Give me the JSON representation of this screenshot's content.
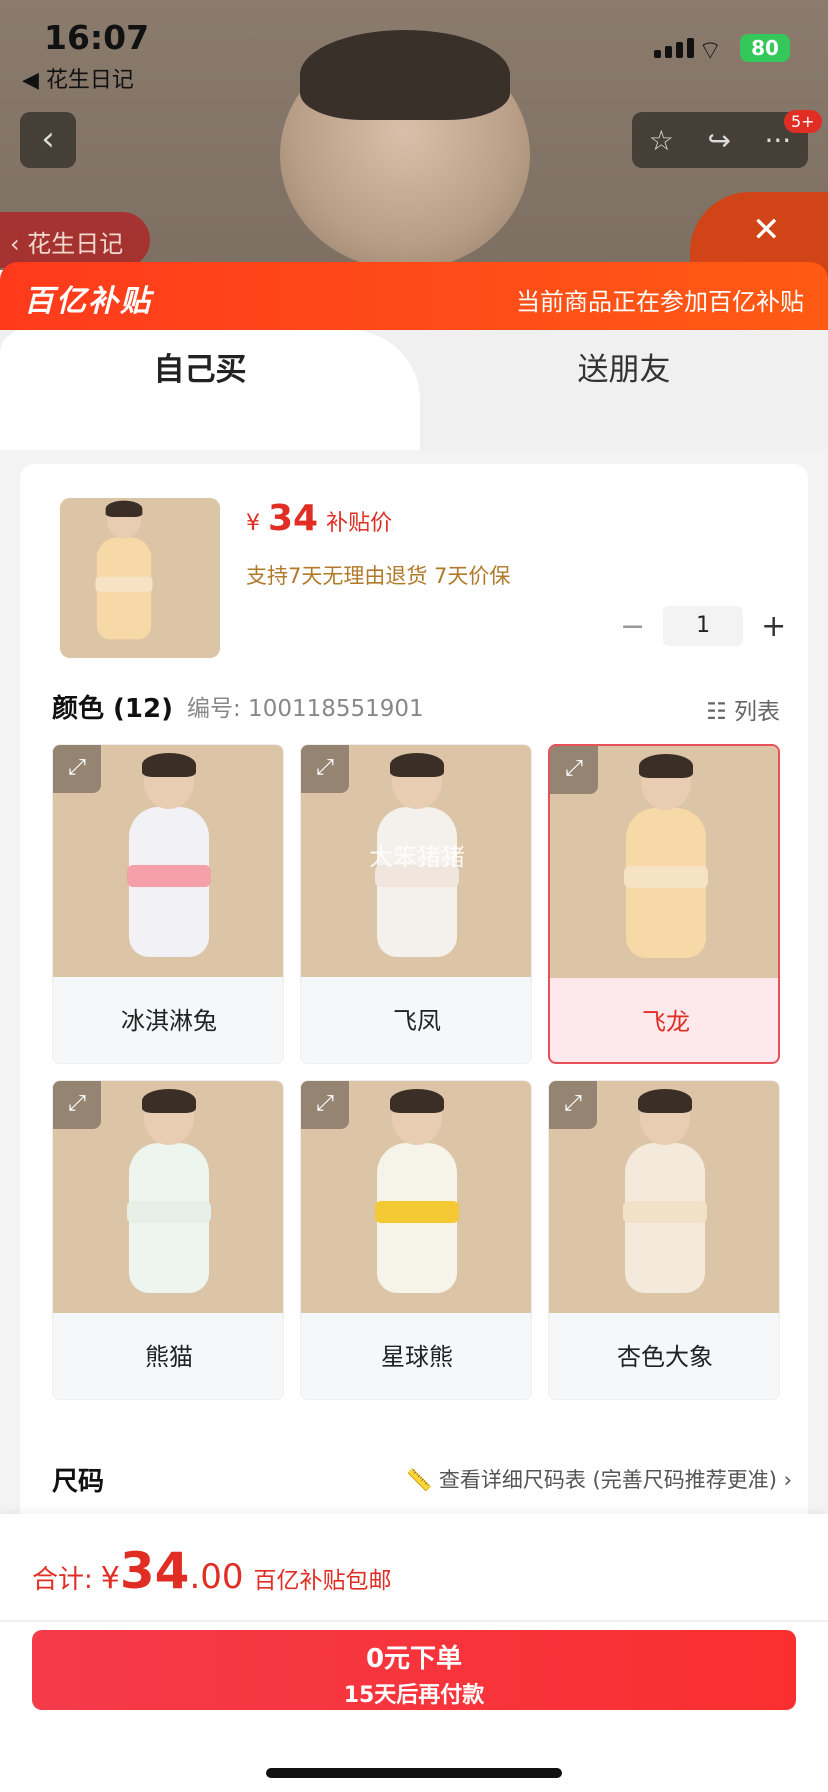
{
  "status_bar": {
    "time": "16:07",
    "back_app": "◀ 花生日记",
    "battery": "80"
  },
  "header": {
    "shop_tag": "花生日记",
    "badge": "5+"
  },
  "banner": {
    "logo": "百亿补贴",
    "text": "当前商品正在参加百亿补贴"
  },
  "tabs": [
    {
      "label": "自己买"
    },
    {
      "label": "送朋友"
    }
  ],
  "product": {
    "currency": "¥",
    "price": "34",
    "price_label": "补贴价",
    "promise": "支持7天无理由退货   7天价保",
    "quantity": "1"
  },
  "color_section": {
    "title": "颜色 (12)",
    "code": "编号: 100118551901",
    "list_label": "列表"
  },
  "colors": [
    {
      "label": "冰淇淋兔",
      "color": "#f2f2f6",
      "belt": "#f5a0a8"
    },
    {
      "label": "飞凤",
      "color": "#f4f0ec",
      "belt": "#f0e6de",
      "watermark": "大笨猪猪"
    },
    {
      "label": "飞龙",
      "color": "#f7d9a8",
      "belt": "#f5e3c4",
      "selected": true
    },
    {
      "label": "熊猫",
      "color": "#eef4ee",
      "belt": "#e6efe8"
    },
    {
      "label": "星球熊",
      "color": "#f6f3e8",
      "belt": "#f5c933"
    },
    {
      "label": "杏色大象",
      "color": "#f4eadc",
      "belt": "#f1e1c6"
    }
  ],
  "size_section": {
    "title": "尺码",
    "link": "查看详细尺码表 (完善尺码推荐更准)"
  },
  "footer": {
    "total_label": "合计:",
    "currency": "¥",
    "total_int": "34",
    "total_dec": ".00",
    "shipping": "百亿补贴包邮",
    "cta_line1": "0元下单",
    "cta_line2": "15天后再付款"
  }
}
